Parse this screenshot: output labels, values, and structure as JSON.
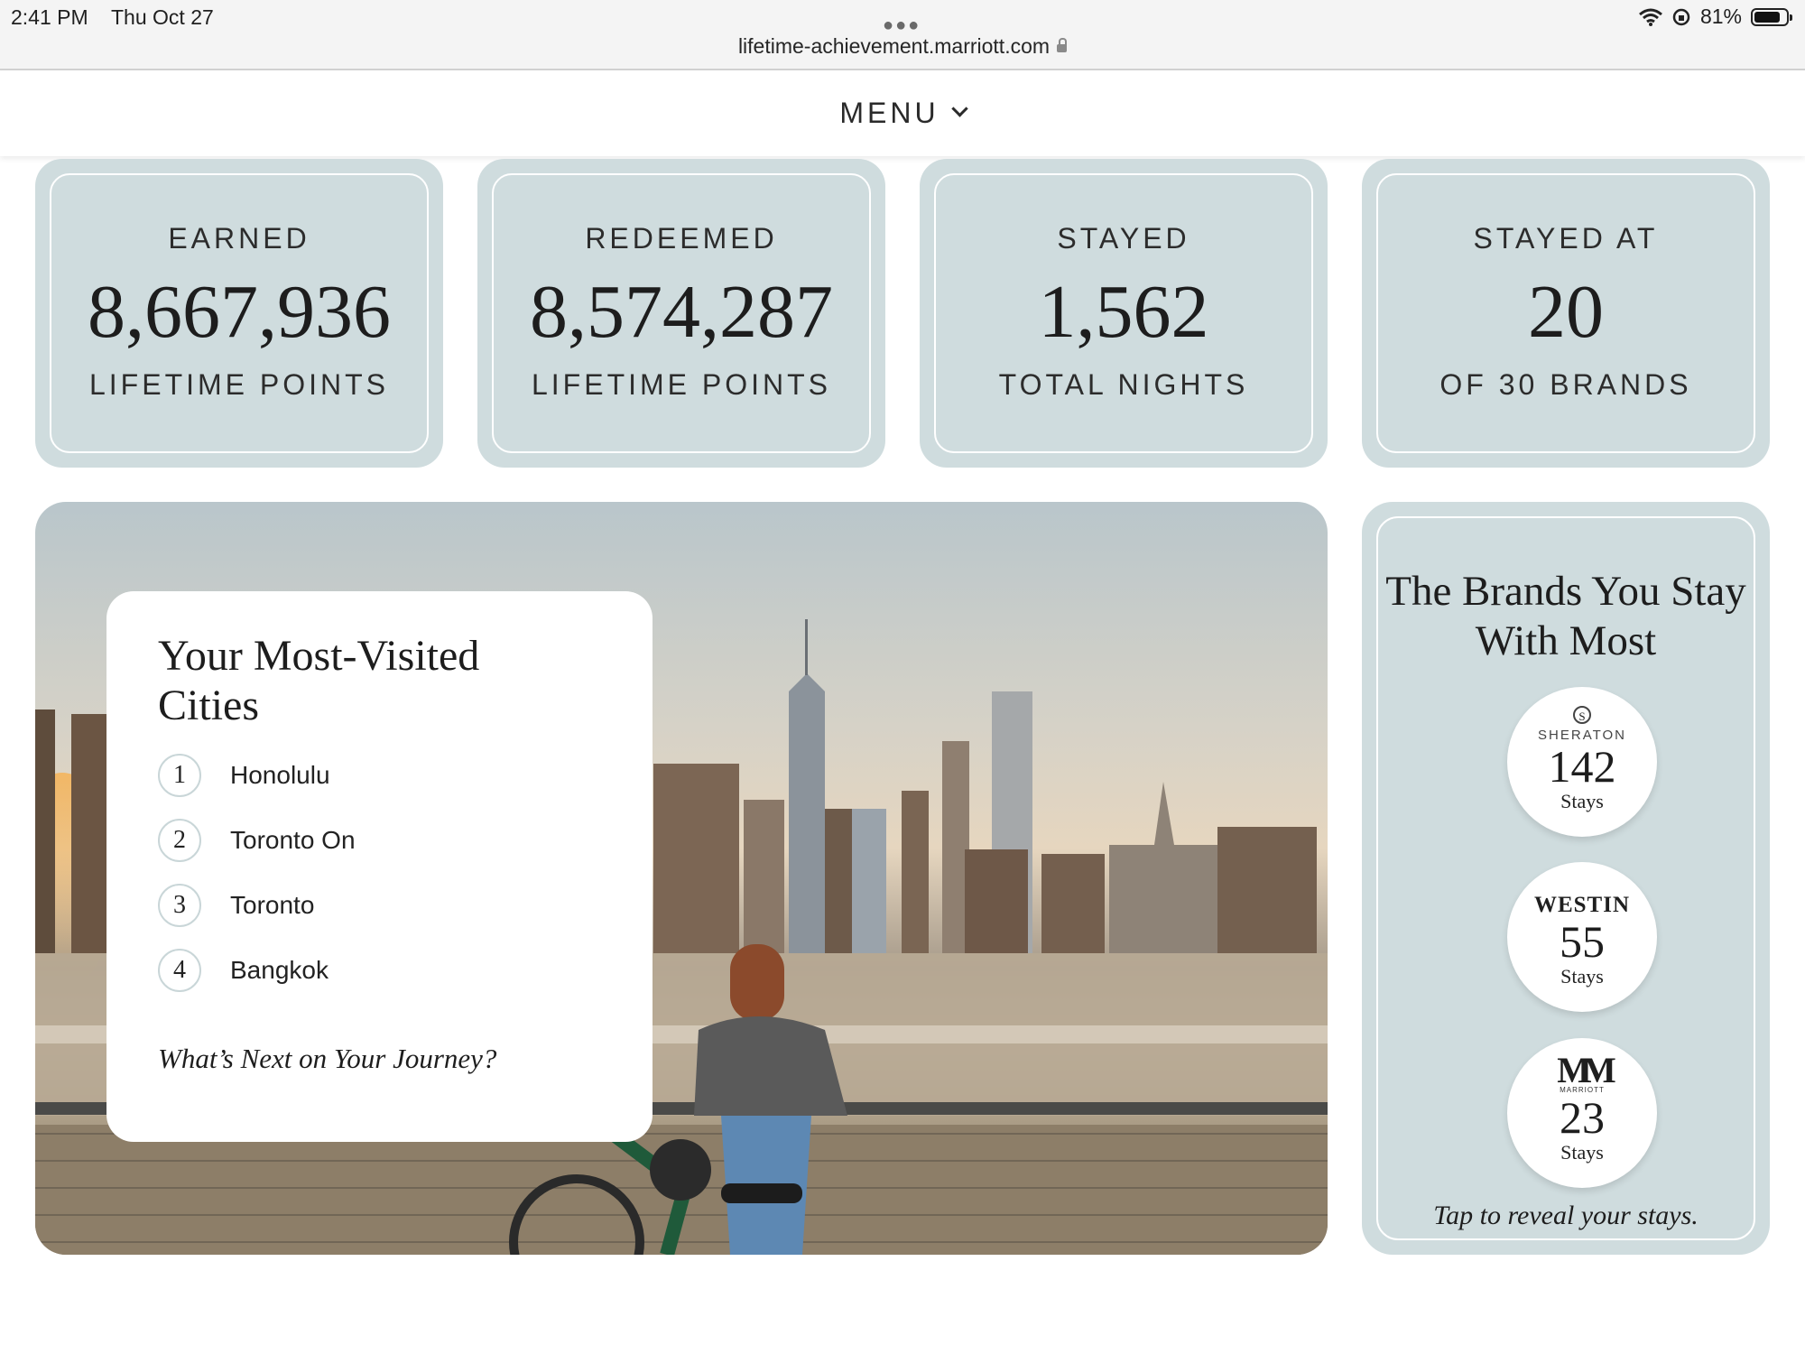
{
  "status_bar": {
    "time": "2:41 PM",
    "date": "Thu Oct 27",
    "battery": "81%",
    "url": "lifetime-achievement.marriott.com"
  },
  "menu": {
    "label": "MENU"
  },
  "stats": [
    {
      "top": "EARNED",
      "value": "8,667,936",
      "bottom": "LIFETIME POINTS"
    },
    {
      "top": "REDEEMED",
      "value": "8,574,287",
      "bottom": "LIFETIME POINTS"
    },
    {
      "top": "STAYED",
      "value": "1,562",
      "bottom": "TOTAL NIGHTS"
    },
    {
      "top": "STAYED AT",
      "value": "20",
      "bottom": "OF 30 BRANDS"
    }
  ],
  "cities": {
    "title": "Your Most-Visited Cities",
    "items": [
      {
        "rank": "1",
        "name": "Honolulu"
      },
      {
        "rank": "2",
        "name": "Toronto On"
      },
      {
        "rank": "3",
        "name": "Toronto"
      },
      {
        "rank": "4",
        "name": "Bangkok"
      }
    ],
    "cta": "What’s Next on Your Journey?"
  },
  "brands": {
    "title": "The Brands You Stay With Most",
    "items": [
      {
        "logo": "SHERATON",
        "count": "142",
        "unit": "Stays"
      },
      {
        "logo": "WESTIN",
        "count": "55",
        "unit": "Stays"
      },
      {
        "logo": "MARRIOTT",
        "count": "23",
        "unit": "Stays"
      }
    ],
    "hint": "Tap to reveal your stays."
  },
  "colors": {
    "card_bg": "#cfdcde",
    "text": "#1d1d1d"
  },
  "icons": [
    "wifi-icon",
    "orientation-lock-icon",
    "battery-icon",
    "lock-icon",
    "chevron-down-icon",
    "sheraton-logo-icon",
    "marriott-logo-icon"
  ]
}
